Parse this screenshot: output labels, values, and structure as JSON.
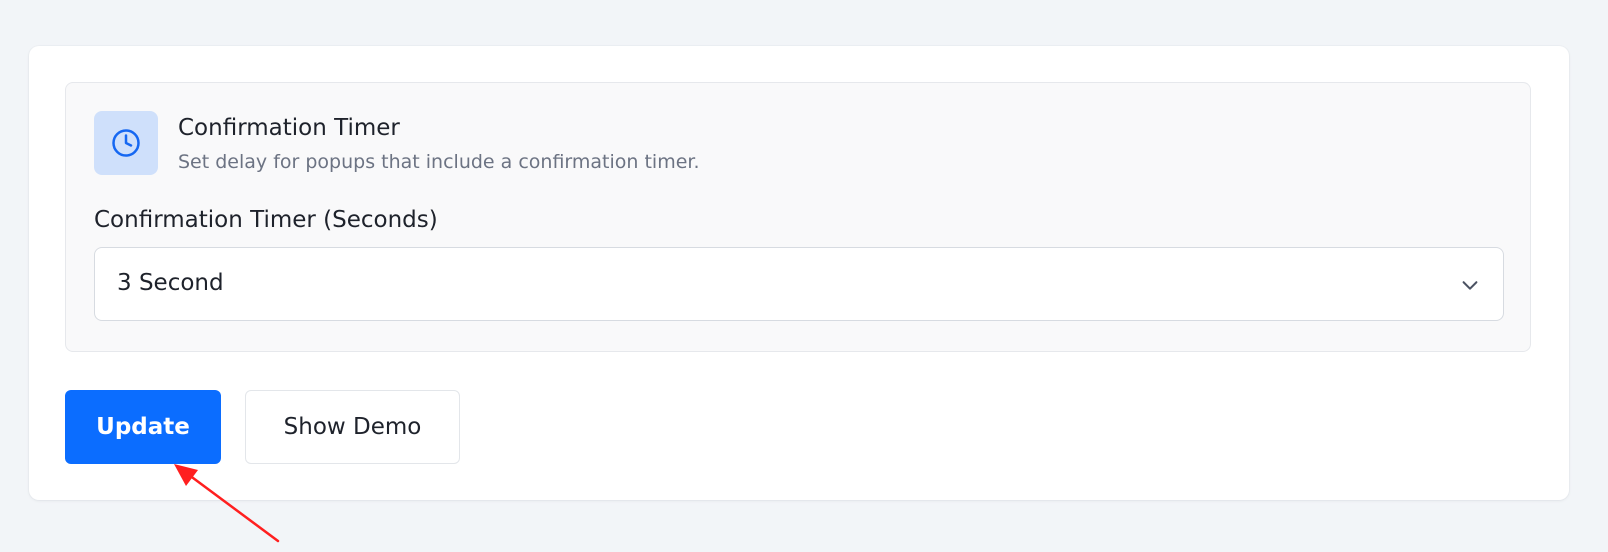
{
  "section": {
    "title": "Confirmation Timer",
    "description": "Set delay for popups that include a confirmation timer.",
    "icon": "clock-icon"
  },
  "field": {
    "label": "Confirmation Timer (Seconds)",
    "selected_value": "3 Second",
    "icon": "chevron-down-icon"
  },
  "actions": {
    "update_label": "Update",
    "show_demo_label": "Show Demo"
  },
  "colors": {
    "page_background": "#f2f5f8",
    "accent": "#0b6dff",
    "icon_background": "#cfe0fb",
    "annotation_arrow": "#ff1f1f"
  }
}
